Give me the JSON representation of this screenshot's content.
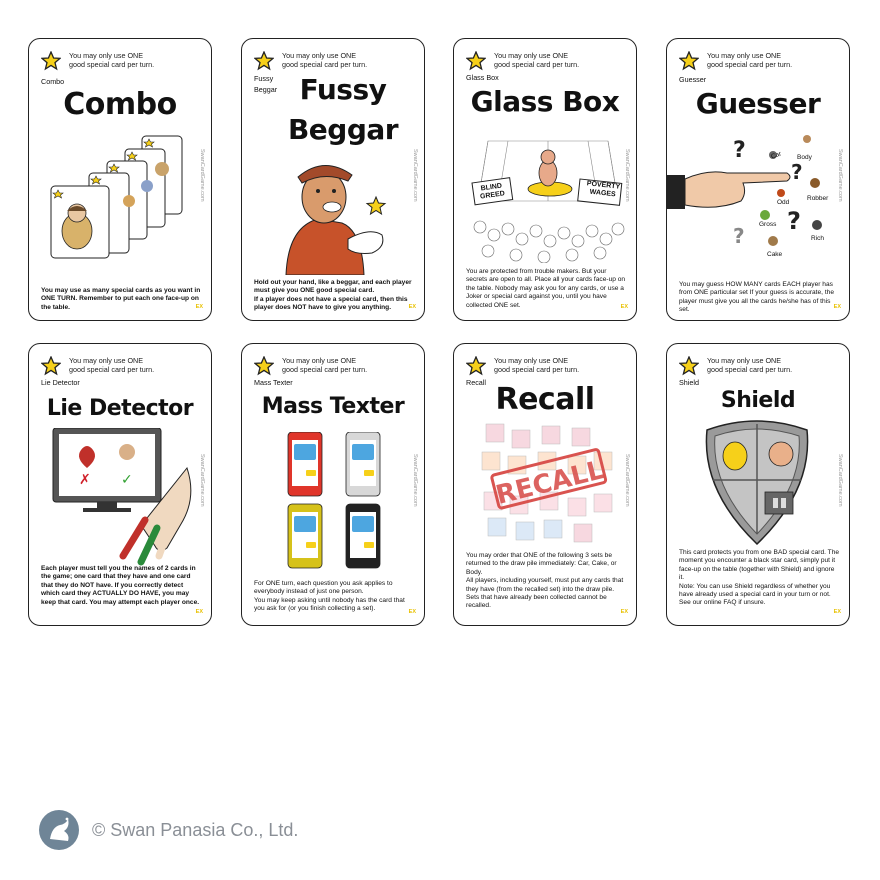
{
  "rule_text": "You may only use ONE\ngood special card per turn.",
  "side_text": "SwanCardGame.com",
  "ex_label": "EX",
  "colors": {
    "star": "#f6d01a",
    "star_outline": "#222222",
    "border": "#222222",
    "footer_text": "#8a8f96",
    "ex": "#e8c100"
  },
  "cards": [
    {
      "label": "Combo",
      "title": "Combo",
      "desc": "You may use as many special cards as you want in ONE TURN. Remember to put each one face-up on the table.",
      "art_icon": "card-fan-icon"
    },
    {
      "label": "Fussy\nBeggar",
      "title_lines": [
        "Fussy",
        "Beggar"
      ],
      "desc": "Hold out your hand, like a beggar, and each player must give you ONE good special card.\nIf a player does not have a special card, then this player does NOT have to give you anything.",
      "art_icon": "beggar-icon"
    },
    {
      "label": "Glass Box",
      "title": "Glass Box",
      "desc": "You are protected from trouble makers. But your secrets are open to all. Place all your cards face-up on the table. Nobody may ask you for any cards, or use a Joker or special card against you, until you have collected ONE set.",
      "sign_left": "BLIND GREED",
      "sign_right": "POVERTY WAGES",
      "art_icon": "glass-box-crowd-icon"
    },
    {
      "label": "Guesser",
      "title": "Guesser",
      "desc": "You may guess HOW MANY cards EACH player has from ONE particular set If your guess is accurate, the player must give you all the cards he/she has of this set.",
      "words": [
        "Car",
        "Body",
        "Odd",
        "Robber",
        "Gross",
        "Rich",
        "Cake"
      ],
      "art_icon": "pointing-hand-icon"
    },
    {
      "label": "Lie Detector",
      "title": "Lie Detector",
      "desc": "Each player must tell you the names of 2 cards in the game; one card that they have and one card that they do NOT have. If you correctly detect which card they ACTUALLY DO HAVE, you may keep that card. You may attempt each player once.",
      "art_icon": "lie-detector-tv-icon"
    },
    {
      "label": "Mass Texter",
      "title": "Mass Texter",
      "desc": "For ONE turn, each question you ask applies to everybody instead of just one person.\nYou may keep asking until nobody has the card that you ask for (or you finish collecting a set).",
      "art_icon": "phones-icon"
    },
    {
      "label": "Recall",
      "title": "Recall",
      "desc": "You may order that ONE of the following 3 sets be returned to the draw pile immediately: Car, Cake, or Body.\nAll players, including yourself, must put any cards that they have (from the recalled set) into the draw pile. Sets that have already been collected cannot be recalled.",
      "stamp": "RECALL",
      "art_icon": "recall-stamp-icon"
    },
    {
      "label": "Shield",
      "title": "Shield",
      "desc": "This card protects you from one BAD special card. The moment you encounter a black star card, simply put it face-up on the table (together with Shield) and ignore it.\nNote: You can use Shield regardless of whether you have already used a special card in your turn or not.\nSee our online FAQ if unsure.",
      "art_icon": "shield-icon"
    }
  ],
  "footer": {
    "logo_text": "SWAN PANASIA",
    "copyright": "© Swan Panasia Co., Ltd."
  }
}
